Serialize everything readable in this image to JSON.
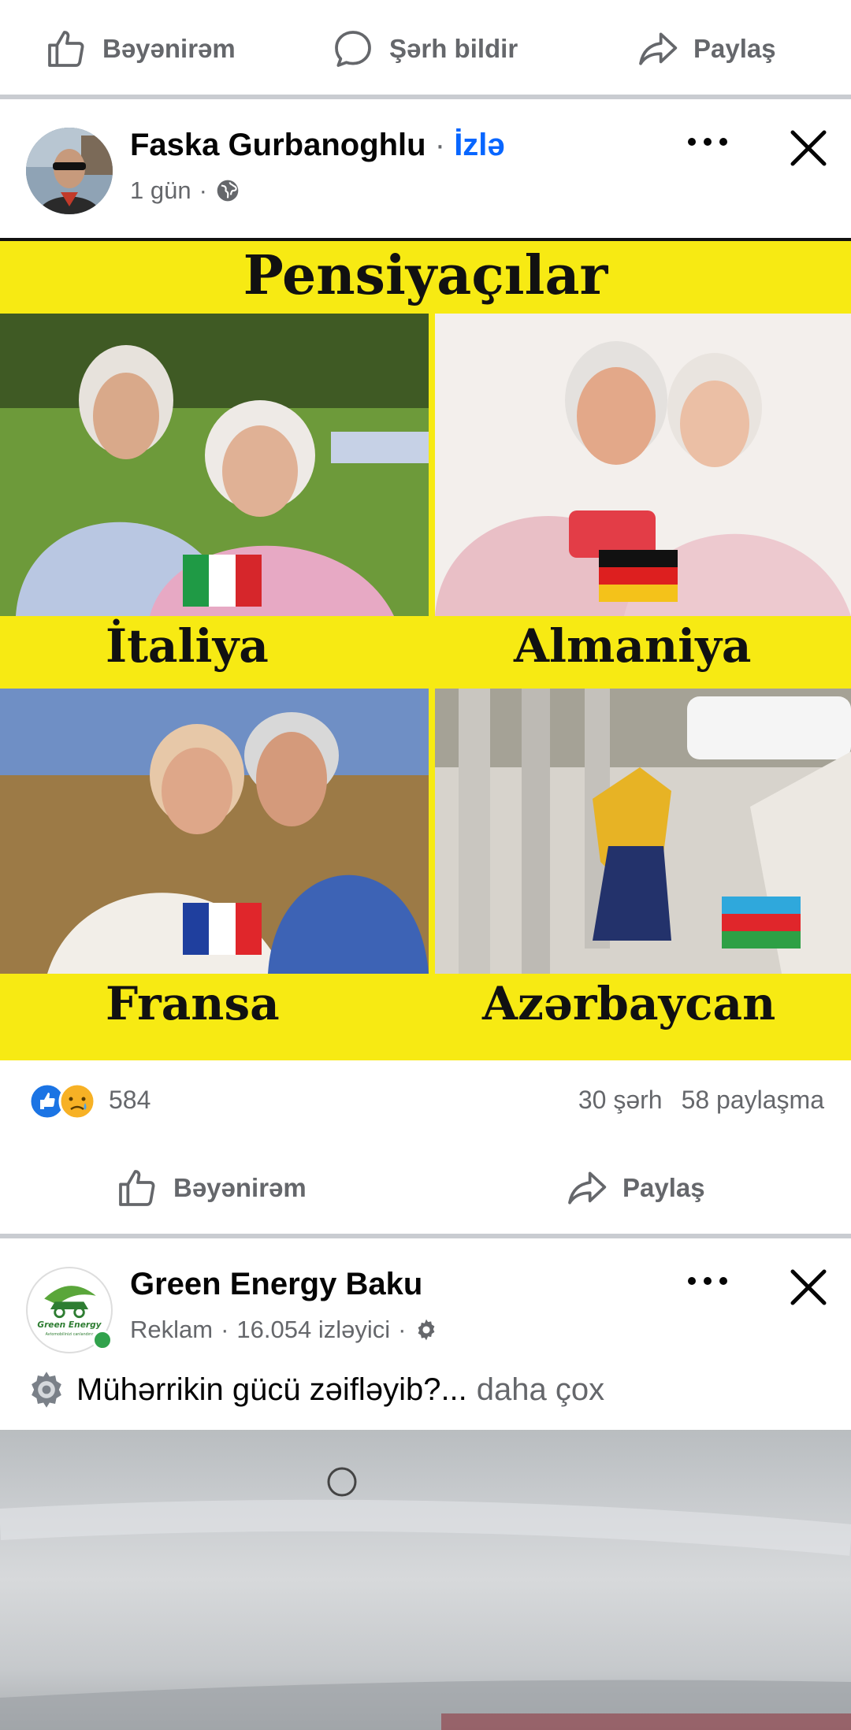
{
  "top_actions": {
    "like_label": "Bəyənirəm",
    "comment_label": "Şərh bildir",
    "share_label": "Paylaş"
  },
  "post1": {
    "author": "Faska Gurbanoghlu",
    "separator": "·",
    "follow_label": "İzlə",
    "time": "1 gün",
    "meta_separator": "·",
    "privacy_icon": "globe-icon",
    "image": {
      "title": "Pensiyaçılar",
      "panels": [
        {
          "country": "İtaliya"
        },
        {
          "country": "Almaniya"
        },
        {
          "country": "Fransa"
        },
        {
          "country": "Azərbaycan"
        }
      ]
    },
    "reaction_count": "584",
    "comments": "30 şərh",
    "shares": "58 paylaşma",
    "actions": {
      "like_label": "Bəyənirəm",
      "share_label": "Paylaş"
    }
  },
  "post2": {
    "author": "Green Energy Baku",
    "sponsored": "Reklam",
    "followers": "16.054 izləyici",
    "sep1": "·",
    "sep2": "·",
    "avatar_text": "Green Energy",
    "avatar_subtext": "Avtomobilinizi canlandırır",
    "text": "Mühərrikin gücü zəifləyib?...",
    "more_label": "daha çox"
  },
  "colors": {
    "accent": "#0866ff",
    "meme_yellow": "#f7ea13",
    "muted_text": "#65676b",
    "divider": "#c9ccd1"
  }
}
